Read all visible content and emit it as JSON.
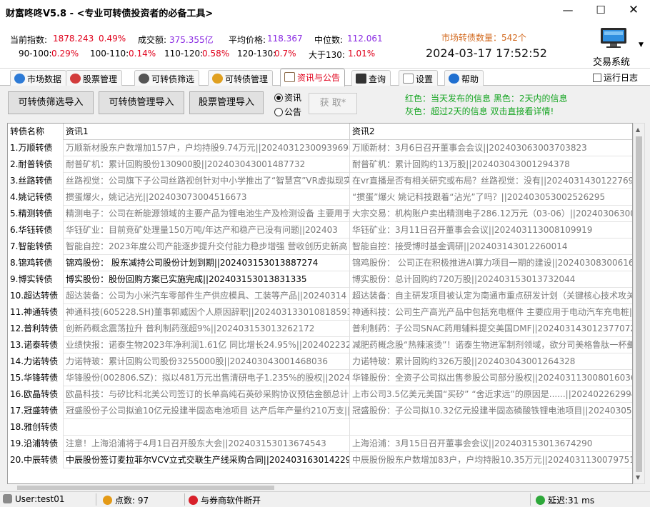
{
  "window": {
    "title": "财富咚咚V5.8 - <专业可转债投资者的必备工具>",
    "minimize": "—",
    "maximize": "☐",
    "close": "✕"
  },
  "stats": {
    "index_label": "当前指数:",
    "index_value": "1878.243",
    "index_change": "0.49%",
    "turnover_label": "成交额:",
    "turnover_value": "375.355亿",
    "avg_price_label": "平均价格:",
    "avg_price_value": "118.367",
    "median_label": "中位数:",
    "median_value": "112.061",
    "market_count": "市场转债数量：542个",
    "buckets": [
      {
        "label": "90-100:",
        "value": "0.29%"
      },
      {
        "label": "100-110:",
        "value": "0.14%"
      },
      {
        "label": "110-120:",
        "value": "0.58%"
      },
      {
        "label": "120-130:",
        "value": "0.7%"
      },
      {
        "label": "大于130:",
        "value": "1.01%"
      }
    ],
    "datetime": "2024-03-17 17:52:52",
    "trade_system": "交易系统",
    "dropdown": "▼"
  },
  "tabs": [
    {
      "label": "市场数据",
      "icon": "globe-icon",
      "color": "#2e7bd6"
    },
    {
      "label": "股票管理",
      "icon": "target-icon",
      "color": "#d23c3c"
    },
    {
      "label": "可转债筛选",
      "icon": "magnifier-icon",
      "color": "#555555"
    },
    {
      "label": "可转债管理",
      "icon": "coins-icon",
      "color": "#e0a020"
    },
    {
      "label": "资讯与公告",
      "icon": "clipboard-icon",
      "color": "#8b6b4a",
      "active": true
    },
    {
      "label": "查询",
      "icon": "terminal-icon",
      "color": "#333333"
    },
    {
      "label": "设置",
      "icon": "gear-icon",
      "color": "#888888"
    },
    {
      "label": "帮助",
      "icon": "help-globe-icon",
      "color": "#1f6fd0"
    }
  ],
  "run_log": "运行日志",
  "toolbar": {
    "import_screen": "可转债筛选导入",
    "import_manage": "可转债管理导入",
    "import_stock": "股票管理导入",
    "radio_news": "资讯",
    "radio_notice": "公告",
    "fetch": "获 取*",
    "legend_line1": "红色：当天发布的信息   黑色：2天内的信息",
    "legend_line2": "灰色：超过2天的信息    双击直接看详情!"
  },
  "table": {
    "headers": [
      "转债名称",
      "资讯1",
      "资讯2"
    ],
    "rows": [
      {
        "name": "1.万顺转债",
        "c1": "万顺新材股东户数增加157户，户均持股9.74万元||202403123009396980",
        "c2": "万顺新材：3月6日召开董事会会议||202403063003703823",
        "s1": "gray",
        "s2": "gray"
      },
      {
        "name": "2.耐普转债",
        "c1": "耐普矿机：累计回购股份130900股||202403043001487732",
        "c2": "耐普矿机：累计回购约13万股||202403043001294378",
        "s1": "gray",
        "s2": "gray"
      },
      {
        "name": "3.丝路转债",
        "c1": "丝路视觉：公司旗下子公司丝路视创针对中小学推出了“智慧宫”VR虚拟现实",
        "c2": "在vr直播是否有相关研究或布局？丝路视觉：没有||202403143012276916",
        "s1": "gray",
        "s2": "gray"
      },
      {
        "name": "4.姚记转债",
        "c1": "掼蛋爆火，姚记沾光||202403073004516673",
        "c2": "“掼蛋”爆火 姚记科技跟着“沾光”了吗？||202403053002526295",
        "s1": "gray",
        "s2": "gray"
      },
      {
        "name": "5.精测转债",
        "c1": "精测电子：公司在新能源领域的主要产品为锂电池生产及检测设备 主要用于",
        "c2": "大宗交易：机构账户卖出精测电子286.12万元（03-06）||202403063003559",
        "s1": "gray",
        "s2": "gray"
      },
      {
        "name": "6.华钰转债",
        "c1": "华钰矿业：目前竞矿处理量150万吨/年达产和稳产已没有问题||202403",
        "c2": "华钰矿业：3月11日召开董事会会议||202403113008109919",
        "s1": "gray",
        "s2": "gray"
      },
      {
        "name": "7.智能转债",
        "c1": "智能自控：2023年度公司产能逐步提升交付能力稳步增强 营收创历史新高",
        "c2": "智能自控：接受博时基金调研||202403143012260014",
        "s1": "gray",
        "s2": "gray"
      },
      {
        "name": "8.锦鸡转债",
        "c1": "锦鸡股份：  股东减持公司股份计划到期||202403153013887274",
        "c2": "锦鸡股份：  公司正在积极推进AI算力项目一期的建设||2024030830061617",
        "s1": "black",
        "s2": "gray"
      },
      {
        "name": "9.博实转债",
        "c1": "博实股份：股份回购方案已实施完成||202403153013831335",
        "c2": "博实股份：总计回购约720万股||202403153013732044",
        "s1": "black",
        "s2": "gray"
      },
      {
        "name": "10.超达转债",
        "c1": "超达装备：公司为小米汽车零部件生产供应模具、工装等产品||20240314",
        "c2": "超达装备：自主研发项目被认定为南通市重点研发计划（关键核心技术攻关",
        "s1": "gray",
        "s2": "gray"
      },
      {
        "name": "11.神通转债",
        "c1": "神通科技(605228.SH)董事郭威因个人原因辞职||202403133010818593",
        "c2": "神通科技：公司生产高光产品中包括充电框件 主要应用于电动汽车充电桩||",
        "s1": "gray",
        "s2": "gray"
      },
      {
        "name": "12.普利转债",
        "c1": "创新药概念震荡拉升 普利制药涨超9%||202403153013262172",
        "c2": "普利制药：子公司SNAC药用辅料提交美国DMF||202403143012377072",
        "s1": "gray",
        "s2": "gray"
      },
      {
        "name": "13.诺泰转债",
        "c1": "业绩快报：诺泰生物2023年净利润1.61亿 同比增长24.95%||20240223299",
        "c2": "减肥药概念股“热辣滚烫”！诺泰生物进军制剂领域，欲分司美格鲁肽一杯羹",
        "s1": "gray",
        "s2": "gray"
      },
      {
        "name": "14.力诺转债",
        "c1": "力诺特玻：累计回购公司股份3255000股||202403043001468036",
        "c2": "力诺特玻：累计回购约326万股||202403043001264328",
        "s1": "gray",
        "s2": "gray"
      },
      {
        "name": "15.华锋转债",
        "c1": "华锋股份(002806.SZ)：拟以481万元出售清研电子1.235%的股权||2024031",
        "c2": "华锋股份：全资子公司拟出售参股公司部分股权||202403113008016036",
        "s1": "gray",
        "s2": "gray"
      },
      {
        "name": "16.欧晶转债",
        "c1": "欧晶科技：与矽比科北美公司签订的长单高纯石英砂采购协议预估金额总计",
        "c2": "上市公司3.5亿美元美国“买矽” “舍近求远”的原因是......||202402262994608",
        "s1": "gray",
        "s2": "gray"
      },
      {
        "name": "17.冠盛转债",
        "c1": "冠盛股份子公司拟逾10亿元投建半固态电池项目 达产后年产量约210万支||",
        "c2": "冠盛股份：子公司拟10.32亿元投建半固态磷酸铁锂电池项目||2024030530",
        "s1": "gray",
        "s2": "gray"
      },
      {
        "name": "18.雅创转债",
        "c1": "",
        "c2": "",
        "s1": "gray",
        "s2": "gray"
      },
      {
        "name": "19.沿浦转债",
        "c1": "注意！上海沿浦将于4月1日召开股东大会||202403153013674543",
        "c2": "上海沿浦：3月15日召开董事会会议||202403153013674290",
        "s1": "gray",
        "s2": "gray"
      },
      {
        "name": "20.中辰转债",
        "c1": "中辰股份签订麦拉菲尔VCV立式交联生产线采购合同||202403163014229",
        "c2": "中辰股份股东户数增加83户，户均持股10.35万元||202403113007975186",
        "s1": "black",
        "s2": "gray"
      }
    ]
  },
  "statusbar": {
    "user": "User:test01",
    "points": "点数:  97",
    "broker": "与券商软件断开",
    "latency": "延迟:31 ms"
  }
}
